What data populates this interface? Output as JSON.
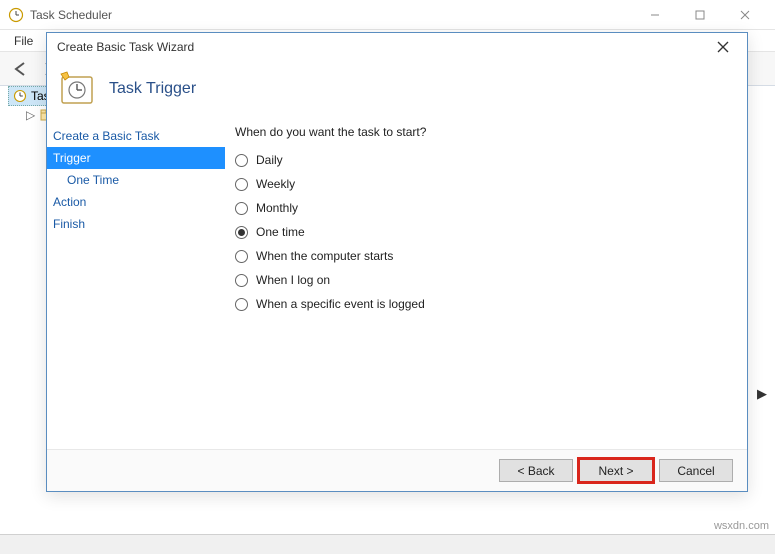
{
  "main_window": {
    "title": "Task Scheduler",
    "menu": {
      "file": "File"
    },
    "tree": {
      "root_label": "Task",
      "child_label": ""
    }
  },
  "wizard": {
    "title": "Create Basic Task Wizard",
    "header": "Task Trigger",
    "steps": {
      "create": "Create a Basic Task",
      "trigger": "Trigger",
      "one_time": "One Time",
      "action": "Action",
      "finish": "Finish"
    },
    "prompt": "When do you want the task to start?",
    "options": {
      "daily": "Daily",
      "weekly": "Weekly",
      "monthly": "Monthly",
      "onetime": "One time",
      "startup": "When the computer starts",
      "logon": "When I log on",
      "event": "When a specific event is logged"
    },
    "selected_option": "onetime",
    "buttons": {
      "back": "< Back",
      "next": "Next >",
      "cancel": "Cancel"
    }
  },
  "watermark": "wsxdn.com"
}
